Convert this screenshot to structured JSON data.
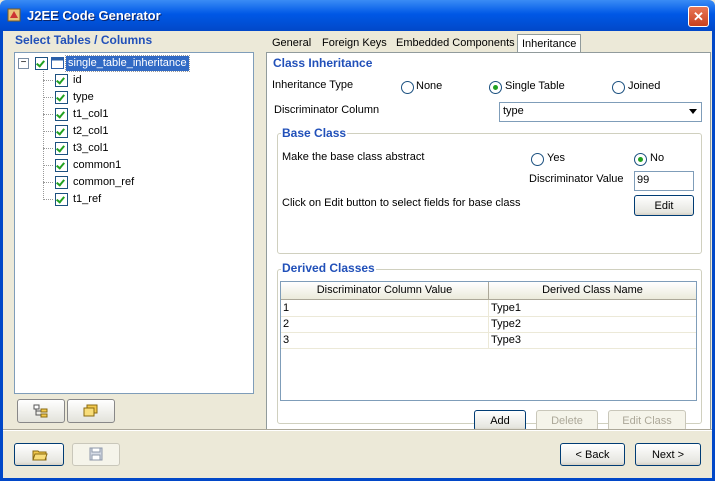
{
  "window": {
    "title": "J2EE Code Generator",
    "close_glyph": "✕"
  },
  "left_panel": {
    "title": "Select Tables / Columns",
    "tree": {
      "expander": "−",
      "root": {
        "label": "single_table_inheritance",
        "checked": true
      },
      "children": [
        {
          "label": "id",
          "checked": true
        },
        {
          "label": "type",
          "checked": true
        },
        {
          "label": "t1_col1",
          "checked": true
        },
        {
          "label": "t2_col1",
          "checked": true
        },
        {
          "label": "t3_col1",
          "checked": true
        },
        {
          "label": "common1",
          "checked": true
        },
        {
          "label": "common_ref",
          "checked": true
        },
        {
          "label": "t1_ref",
          "checked": true
        }
      ]
    }
  },
  "tabs": [
    "General",
    "Foreign Keys",
    "Embedded Components",
    "Inheritance"
  ],
  "active_tab": "Inheritance",
  "class_inheritance": {
    "title": "Class Inheritance",
    "inheritance_type_label": "Inheritance Type",
    "options": [
      "None",
      "Single Table",
      "Joined"
    ],
    "selected": "Single Table",
    "discriminator_column_label": "Discriminator Column",
    "discriminator_column_value": "type"
  },
  "base_class": {
    "title": "Base Class",
    "abstract_label": "Make the base class abstract",
    "abstract_options": [
      "Yes",
      "No"
    ],
    "abstract_selected": "No",
    "discriminator_value_label": "Discriminator Value",
    "discriminator_value": "99",
    "edit_hint": "Click on Edit button to select fields for base class",
    "edit_button": "Edit"
  },
  "derived_classes": {
    "title": "Derived Classes",
    "columns": [
      "Discriminator Column Value",
      "Derived Class Name"
    ],
    "rows": [
      [
        "1",
        "Type1"
      ],
      [
        "2",
        "Type2"
      ],
      [
        "3",
        "Type3"
      ]
    ],
    "add_button": "Add",
    "delete_button": "Delete",
    "edit_class_button": "Edit Class"
  },
  "footer": {
    "back_button": "< Back",
    "next_button": "Next >"
  },
  "colors": {
    "titlebar": "#0058E6",
    "section_title": "#2150B9",
    "selection": "#316AC5",
    "check": "#21A121"
  },
  "icons": [
    "application-icon",
    "close-icon",
    "tree-expand-icon",
    "table-icon",
    "tree-layout-icon",
    "folder-icon",
    "open-folder-icon",
    "save-icon"
  ]
}
